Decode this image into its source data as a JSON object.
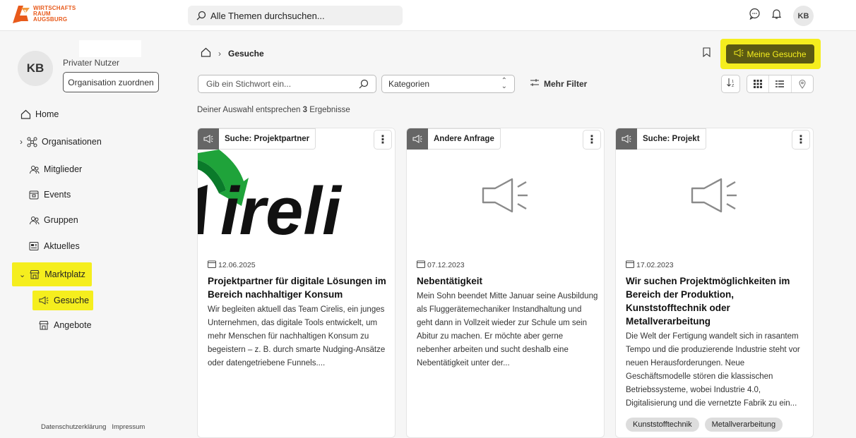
{
  "header": {
    "logo": {
      "line1": "WIRTSCHAFTS",
      "line2": "RAUM",
      "line3": "AUGSBURG"
    },
    "search_placeholder": "Alle Themen durchsuchen...",
    "avatar_initials": "KB"
  },
  "sidebar": {
    "avatar_initials": "KB",
    "user_type": "Privater Nutzer",
    "org_button": "Organisation zuordnen",
    "items": [
      {
        "label": "Home",
        "icon": "home-icon"
      },
      {
        "label": "Organisationen",
        "icon": "network-icon",
        "expandable": true
      },
      {
        "label": "Mitglieder",
        "icon": "users-icon"
      },
      {
        "label": "Events",
        "icon": "calendar-icon"
      },
      {
        "label": "Gruppen",
        "icon": "group-icon"
      },
      {
        "label": "Aktuelles",
        "icon": "news-icon"
      },
      {
        "label": "Marktplatz",
        "icon": "store-icon",
        "expanded": true
      },
      {
        "label": "Gesuche",
        "icon": "megaphone-icon",
        "active": true
      },
      {
        "label": "Angebote",
        "icon": "store-icon"
      }
    ],
    "footer": {
      "privacy": "Datenschutzerklärung",
      "imprint": "Impressum"
    }
  },
  "main": {
    "breadcrumb": {
      "current": "Gesuche"
    },
    "meine_gesuche": "Meine Gesuche",
    "keyword_placeholder": "Gib ein Stichwort ein...",
    "category_select": "Kategorien",
    "more_filters": "Mehr Filter",
    "results_prefix": "Deiner Auswahl entsprechen ",
    "results_count": "3",
    "results_suffix": " Ergebnisse",
    "cards": [
      {
        "tag": "Suche: Projektpartner",
        "image_text": "ireli",
        "date": "12.06.2025",
        "title": "Projektpartner für digitale Lösungen im Bereich nachhaltiger Konsum",
        "description": "Wir begleiten aktuell das Team Cirelis, ein junges Unternehmen, das digitale Tools entwickelt, um mehr Menschen für nachhaltigen Konsum zu begeistern – z. B. durch smarte Nudging-Ansätze oder datengetriebene Funnels...."
      },
      {
        "tag": "Andere Anfrage",
        "date": "07.12.2023",
        "title": "Nebentätigkeit",
        "description": "Mein Sohn beendet Mitte Januar seine Ausbildung als Fluggerätemechaniker Instandhaltung und geht dann in Vollzeit wieder zur Schule um sein Abitur zu machen. Er möchte aber gerne nebenher arbeiten und sucht deshalb eine Nebentätigkeit unter der..."
      },
      {
        "tag": "Suche: Projekt",
        "date": "17.02.2023",
        "title": "Wir suchen Projektmöglichkeiten im Bereich der Produktion, Kunststofftechnik oder Metallverarbeitung",
        "description": "Die Welt der Fertigung wandelt sich in rasantem Tempo und die produzierende Industrie steht vor neuen Herausforderungen. Neue Geschäftsmodelle stören die klassischen Betriebssysteme, wobei Industrie 4.0, Digitalisierung und die vernetzte Fabrik zu ein...",
        "chips": [
          "Kunststofftechnik",
          "Metallverarbeitung"
        ]
      }
    ]
  },
  "colors": {
    "highlight": "#f5ee1e",
    "meine_btn_bg": "#5b5a13",
    "logo_orange": "#e85a1b",
    "tag_icon_bg": "#666666"
  }
}
